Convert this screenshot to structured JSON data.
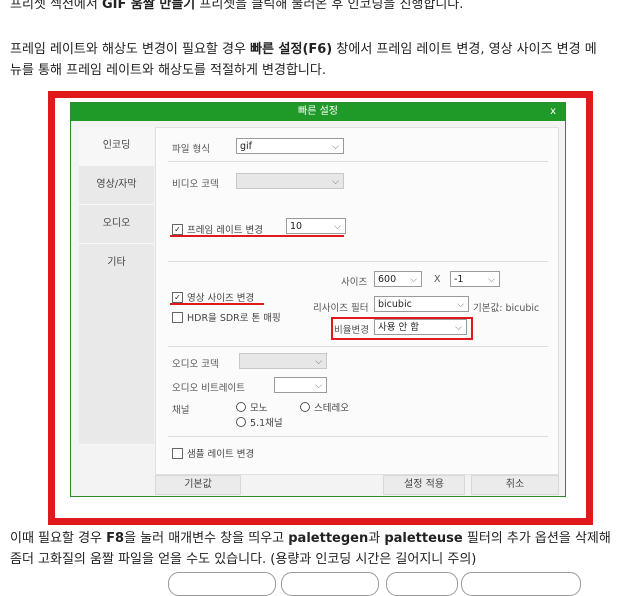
{
  "intro": {
    "line1": {
      "a": "프리셋 섹션에서 ",
      "b": "GIF 움짤 만들기",
      "c": " 프리셋을 클릭해 불러온 후 인코딩을 진행합니다."
    },
    "line2": {
      "a": "프레임 레이트와 해상도 변경이 필요할 경우 ",
      "b": "빠른 설정(F6)",
      "c": " 창에서 프레임 레이트 변경, 영상 사이즈 변경 메"
    },
    "line3": "뉴를 통해 프레임 레이트와 해상도를 적절하게 변경합니다."
  },
  "dialog": {
    "title": "빠른 설정",
    "close": "x",
    "tabs": [
      "인코딩",
      "영상/자막",
      "오디오",
      "기타"
    ],
    "file_format_label": "파일 형식",
    "file_format_value": "gif",
    "video_codec_label": "비디오 코덱",
    "framerate_check": "✓",
    "framerate_label": "프레임 레이트 변경",
    "framerate_value": "10",
    "size_label": "사이즈",
    "size_w": "600",
    "size_x": "X",
    "size_h": "-1",
    "resize_check": "✓",
    "resize_label": "영상 사이즈 변경",
    "resize_filter_label": "리사이즈 필터",
    "resize_filter_value": "bicubic",
    "default_note": "기본값: bicubic",
    "hdr_label": "HDR을 SDR로 톤 매핑",
    "ratio_label": "비율변경",
    "ratio_value": "사용 안 함",
    "audio_codec_label": "오디오 코덱",
    "audio_bitrate_label": "오디오 비트레이트",
    "channel_label": "채널",
    "channel_mono": "모노",
    "channel_stereo": "스테레오",
    "channel_51": "5.1채널",
    "samplerate_label": "샘플 레이트 변경",
    "btn_default": "기본값",
    "btn_apply": "설정 적용",
    "btn_cancel": "취소"
  },
  "outro": {
    "line1": {
      "a": "이때 필요할 경우 ",
      "b": "F8",
      "c": "을 눌러 매개변수 창을 띄우고 ",
      "d": "palettegen",
      "e": "과 ",
      "f": "paletteuse",
      "g": " 필터의 추가 옵션을 삭제해"
    },
    "line2": "좀더 고화질의 움짤 파일을 얻을 수도 있습니다. (용량과 인코딩 시간은 길어지니 주의)"
  },
  "colors": {
    "highlight_red": "#e01a1a",
    "titlebar_green": "#1f9a28"
  }
}
